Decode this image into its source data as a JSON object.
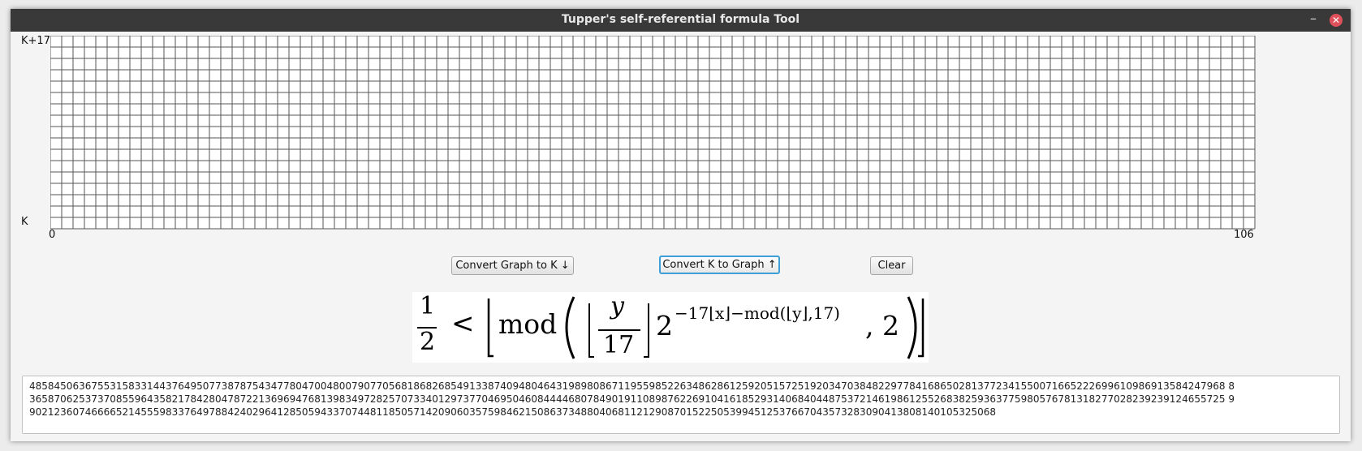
{
  "window": {
    "title": "Tupper's self-referential formula Tool"
  },
  "titlebar": {
    "minimize_glyph": "–",
    "close_glyph": "✕"
  },
  "graph": {
    "y_label_top": "K+17",
    "y_label_bottom": "K",
    "x_label_left": "0",
    "x_label_right": "106",
    "columns": 106,
    "rows": 17,
    "pixel_color": "#000000",
    "grid_line_color": "#555555"
  },
  "buttons": {
    "graph_to_k": "Convert Graph to K ↓",
    "k_to_graph": "Convert K to Graph ↑",
    "clear": "Clear"
  },
  "formula": {
    "half_num": "1",
    "half_den": "2",
    "less_than": "<",
    "mod": "mod",
    "y": "y",
    "seventeen": "17",
    "two": "2",
    "exponent": "−17⌊x⌋−mod(⌊y⌋,17)",
    "comma_two": ", 2"
  },
  "k_value": {
    "lines": [
      "4858450636755315833144376495077387875434778047004800790770568186826854913387409480464319898086711955985226348628612592051572519203470384822977841686502813772341550071665222699610986913584247968 8",
      "3658706253737085596435821784280478722136969476813983497282570733401297377046950460844446807849019110898762269104161852931406840448753721461986125526838259363775980576781318277028239239124655725 9",
      "902123607466665214555983376497884240296412850594337074481185057142090603575984621508637348804068112129087015225053994512537667043573283090413808140105325068"
    ]
  }
}
